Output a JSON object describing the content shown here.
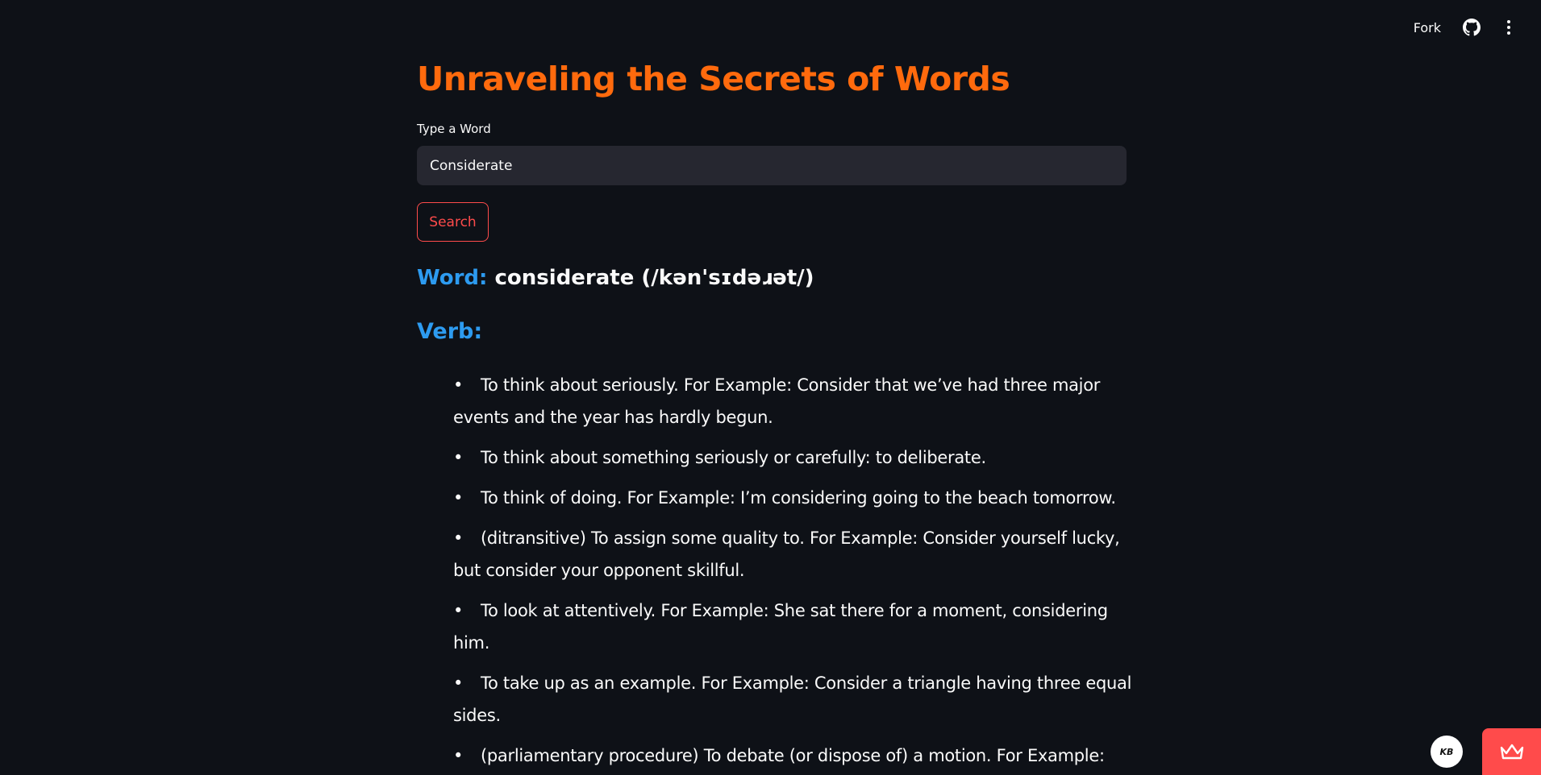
{
  "toolbar": {
    "fork_label": "Fork",
    "github_icon": "github-icon",
    "menu_icon": "more-vertical-icon"
  },
  "header": {
    "title": "Unraveling the Secrets of Words"
  },
  "search": {
    "label": "Type a Word",
    "value": "Considerate",
    "button_label": "Search"
  },
  "result": {
    "word_label": "Word:",
    "word_value": "considerate (/kən'sɪdəɹət/)",
    "part_of_speech": "Verb:",
    "definitions": [
      "To think about seriously. For Example: Consider that we’ve had three major events and the year has hardly begun.",
      "To think about something seriously or carefully: to deliberate.",
      "To think of doing. For Example: I’m considering going to the beach tomorrow.",
      "(ditransitive) To assign some quality to. For Example: Consider yourself lucky, but consider your opponent skillful.",
      "To look at attentively. For Example: She sat there for a moment, considering him.",
      "To take up as an example. For Example: Consider a triangle having three equal sides.",
      "(parliamentary procedure) To debate (or dispose of) a motion. For Example:"
    ]
  },
  "footer": {
    "avatar_text": "KB",
    "crown_icon": "crown-icon"
  },
  "colors": {
    "background": "#0e1117",
    "title": "#ff6a0d",
    "accent_blue": "#2d9bf0",
    "button_red": "#ff4b4b",
    "input_bg": "#262730"
  }
}
